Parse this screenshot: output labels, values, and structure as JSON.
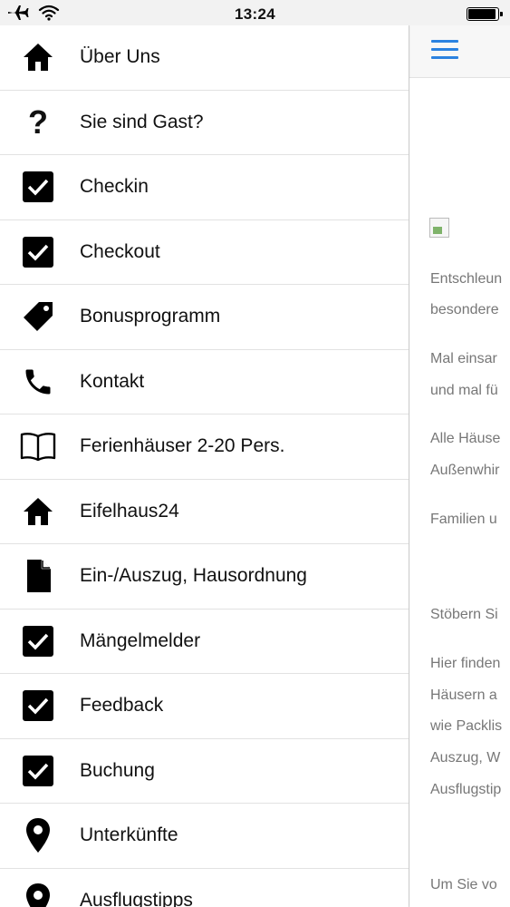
{
  "status_bar": {
    "time": "13:24"
  },
  "menu": {
    "items": [
      {
        "label": "Über Uns",
        "icon": "home-icon"
      },
      {
        "label": "Sie sind Gast?",
        "icon": "question-icon"
      },
      {
        "label": "Checkin",
        "icon": "checkbox-icon"
      },
      {
        "label": "Checkout",
        "icon": "checkbox-icon"
      },
      {
        "label": "Bonusprogramm",
        "icon": "tag-icon"
      },
      {
        "label": "Kontakt",
        "icon": "phone-icon"
      },
      {
        "label": "Ferienhäuser 2-20 Pers.",
        "icon": "book-icon"
      },
      {
        "label": "Eifelhaus24",
        "icon": "home-icon"
      },
      {
        "label": "Ein-/Auszug, Hausordnung",
        "icon": "document-icon"
      },
      {
        "label": "Mängelmelder",
        "icon": "checkbox-icon"
      },
      {
        "label": "Feedback",
        "icon": "checkbox-icon"
      },
      {
        "label": "Buchung",
        "icon": "checkbox-icon"
      },
      {
        "label": "Unterkünfte",
        "icon": "map-pin-icon"
      },
      {
        "label": "Ausflugstipps",
        "icon": "map-pin-icon"
      }
    ]
  },
  "page": {
    "paragraphs": [
      "Entschleun",
      "besondere",
      "Mal einsar",
      "und mal fü",
      "Alle Häuse",
      "Außenwhir",
      "Familien u",
      "Stöbern Si",
      "Hier finden",
      "Häusern a",
      "wie Packlis",
      "Auszug, W",
      "Ausflugstip",
      "Um Sie vo"
    ]
  },
  "colors": {
    "accent": "#2b82e0",
    "text": "#111111",
    "muted": "#777777",
    "divider": "#e2e2e2"
  }
}
